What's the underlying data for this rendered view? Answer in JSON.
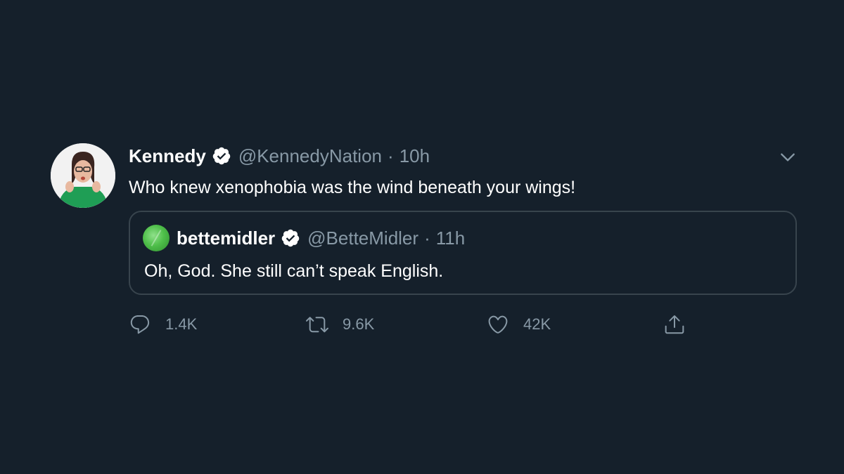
{
  "tweet": {
    "author_name": "Kennedy",
    "author_handle": "@KennedyNation",
    "separator": "·",
    "time": "10h",
    "text": "Who knew xenophobia was the wind beneath your wings!",
    "verified": true,
    "avatar_icon": "user-avatar"
  },
  "quoted_tweet": {
    "author_name": "bettemidler",
    "author_handle": "@BetteMidler",
    "separator": "·",
    "time": "11h",
    "text": "Oh, God.  She still can’t speak English.",
    "verified": true,
    "avatar_icon": "green-avatar"
  },
  "actions": {
    "reply_count": "1.4K",
    "retweet_count": "9.6K",
    "like_count": "42K",
    "share_icon": "share-icon"
  },
  "colors": {
    "background": "#15202b",
    "secondary_text": "#8899a6",
    "border": "#38444d",
    "text": "#ffffff"
  }
}
